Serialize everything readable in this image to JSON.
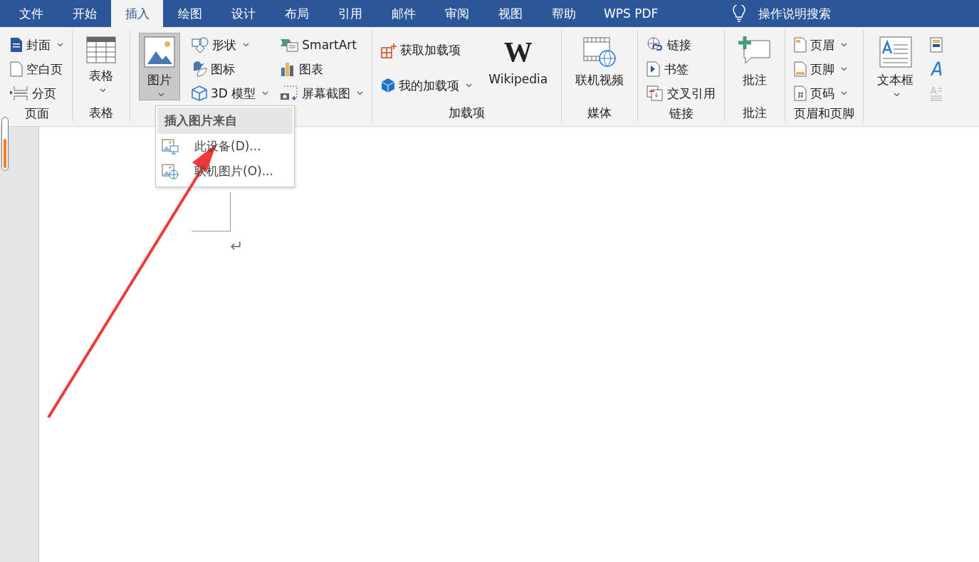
{
  "tabs": [
    {
      "label": "文件",
      "selected": false
    },
    {
      "label": "开始",
      "selected": false
    },
    {
      "label": "插入",
      "selected": true
    },
    {
      "label": "绘图",
      "selected": false
    },
    {
      "label": "设计",
      "selected": false
    },
    {
      "label": "布局",
      "selected": false
    },
    {
      "label": "引用",
      "selected": false
    },
    {
      "label": "邮件",
      "selected": false
    },
    {
      "label": "审阅",
      "selected": false
    },
    {
      "label": "视图",
      "selected": false
    },
    {
      "label": "帮助",
      "selected": false
    },
    {
      "label": "WPS PDF",
      "selected": false
    }
  ],
  "tell_me": {
    "label": "操作说明搜索"
  },
  "ribbon": [
    {
      "label": "页面",
      "columns": [
        [
          {
            "kind": "small",
            "label": "封面",
            "dropdown": true
          },
          {
            "kind": "small",
            "label": "空白页",
            "dropdown": false
          },
          {
            "kind": "small",
            "label": "分页",
            "dropdown": false
          }
        ]
      ]
    },
    {
      "label": "表格",
      "columns": [
        [
          {
            "kind": "large",
            "label": "表格",
            "dropdown": true,
            "pressed": false
          }
        ]
      ]
    },
    {
      "columns": [
        [
          {
            "kind": "large",
            "label": "图片",
            "dropdown": true,
            "pressed": true
          }
        ],
        [
          {
            "kind": "small",
            "label": "形状",
            "dropdown": true
          },
          {
            "kind": "small",
            "label": "图标",
            "dropdown": false
          },
          {
            "kind": "small",
            "label": "3D 模型",
            "dropdown": true
          }
        ],
        [
          {
            "kind": "small",
            "label": "SmartArt",
            "dropdown": false
          },
          {
            "kind": "small",
            "label": "图表",
            "dropdown": false
          },
          {
            "kind": "small",
            "label": "屏幕截图",
            "dropdown": true
          }
        ]
      ]
    },
    {
      "label": "加载项",
      "columns": [
        [
          {
            "kind": "small",
            "label": "获取加载项",
            "dropdown": false
          },
          {
            "kind": "small",
            "label": "我的加载项",
            "dropdown": true
          }
        ],
        [
          {
            "kind": "logo",
            "logo": "W",
            "label": "Wikipedia"
          }
        ]
      ]
    },
    {
      "label": "媒体",
      "columns": [
        [
          {
            "kind": "large",
            "label": "联机视频",
            "dropdown": false,
            "pressed": false
          }
        ]
      ]
    },
    {
      "label": "链接",
      "columns": [
        [
          {
            "kind": "small",
            "label": "链接",
            "dropdown": false
          },
          {
            "kind": "small",
            "label": "书签",
            "dropdown": false
          },
          {
            "kind": "small",
            "label": "交叉引用",
            "dropdown": false
          }
        ]
      ]
    },
    {
      "label": "批注",
      "columns": [
        [
          {
            "kind": "large",
            "label": "批注",
            "dropdown": false,
            "pressed": false
          }
        ]
      ]
    },
    {
      "label": "页眉和页脚",
      "columns": [
        [
          {
            "kind": "small",
            "label": "页眉",
            "dropdown": true
          },
          {
            "kind": "small",
            "label": "页脚",
            "dropdown": true
          },
          {
            "kind": "small",
            "label": "页码",
            "dropdown": true
          }
        ]
      ]
    },
    {
      "columns": [
        [
          {
            "kind": "large",
            "label": "文本框",
            "dropdown": true,
            "pressed": false
          }
        ],
        [
          {
            "kind": "icon"
          },
          {
            "kind": "icon"
          },
          {
            "kind": "icon"
          }
        ]
      ]
    }
  ],
  "picture_menu": {
    "title": "插入图片来自",
    "items": [
      {
        "label": "此设备(D)..."
      },
      {
        "label": "联机图片(O)..."
      }
    ]
  },
  "document": {
    "paragraph_mark": "↵"
  }
}
